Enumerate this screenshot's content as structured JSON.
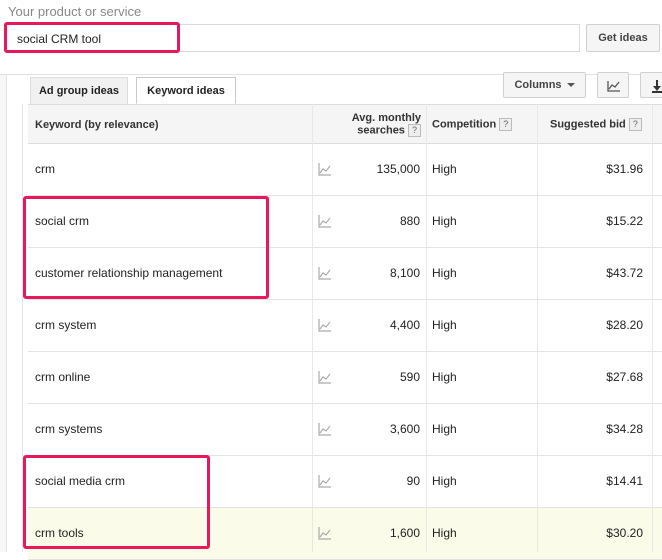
{
  "product_label": "Your product or service",
  "search": {
    "value": "social CRM tool"
  },
  "get_ideas_label": "Get ideas",
  "tabs": [
    {
      "label": "Ad group ideas",
      "active": false
    },
    {
      "label": "Keyword ideas",
      "active": true
    }
  ],
  "toolbar": {
    "columns_label": "Columns",
    "chart_icon": "line-chart-icon",
    "download_icon": "download-icon"
  },
  "table": {
    "headers": {
      "keyword": "Keyword (by relevance)",
      "volume_line1": "Avg. monthly",
      "volume_line2": "searches",
      "competition": "Competition",
      "bid": "Suggested bid",
      "help": "?"
    },
    "rows": [
      {
        "keyword": "crm",
        "volume": "135,000",
        "competition": "High",
        "bid": "$31.96"
      },
      {
        "keyword": "social crm",
        "volume": "880",
        "competition": "High",
        "bid": "$15.22"
      },
      {
        "keyword": "customer relationship management",
        "volume": "8,100",
        "competition": "High",
        "bid": "$43.72"
      },
      {
        "keyword": "crm system",
        "volume": "4,400",
        "competition": "High",
        "bid": "$28.20"
      },
      {
        "keyword": "crm online",
        "volume": "590",
        "competition": "High",
        "bid": "$27.68"
      },
      {
        "keyword": "crm systems",
        "volume": "3,600",
        "competition": "High",
        "bid": "$34.28"
      },
      {
        "keyword": "social media crm",
        "volume": "90",
        "competition": "High",
        "bid": "$14.41"
      },
      {
        "keyword": "crm tools",
        "volume": "1,600",
        "competition": "High",
        "bid": "$30.20",
        "highlighted": true
      }
    ]
  },
  "colors": {
    "annotation": "#e8185b",
    "highlight_row": "#fafbe9"
  }
}
